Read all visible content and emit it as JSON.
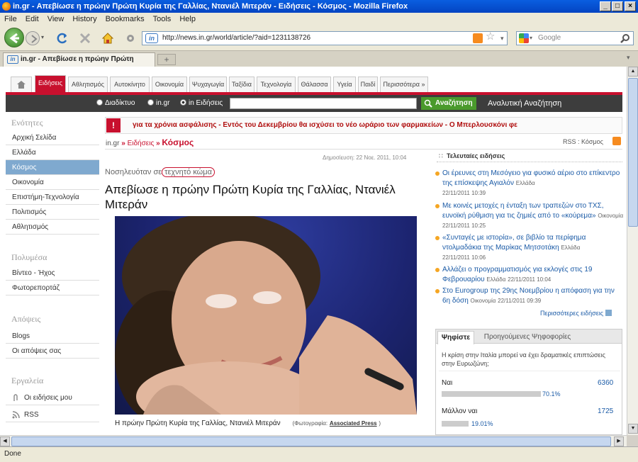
{
  "browser": {
    "window_title": "in.gr - Απεβίωσε η πρώην Πρώτη Κυρία της Γαλλίας, Ντανιέλ Μιτεράν - Ειδήσεις - Κόσμος - Mozilla Firefox",
    "menu": [
      "File",
      "Edit",
      "View",
      "History",
      "Bookmarks",
      "Tools",
      "Help"
    ],
    "url": "http://news.in.gr/world/article/?aid=1231138726",
    "search_placeholder": "Google",
    "tab_title": "in.gr - Απεβίωσε η πρώην Πρώτη Κυρί...",
    "new_tab": "+",
    "status": "Done"
  },
  "site": {
    "tabs": [
      "Ειδήσεις",
      "Αθλητισμός",
      "Αυτοκίνητο",
      "Οικονομία",
      "Ψυχαγωγία",
      "Ταξίδια",
      "Τεχνολογία",
      "Θάλασσα",
      "Υγεία",
      "Παιδί",
      "Περισσότερα »"
    ],
    "search_options": [
      "Διαδίκτυο",
      "in.gr",
      "in Ειδήσεις"
    ],
    "search_button": "Αναζήτηση",
    "advanced_search": "Αναλυτική Αναζήτηση",
    "sidebar": {
      "sections": [
        {
          "heading": "Ενότητες",
          "items": [
            "Αρχική Σελίδα",
            "Ελλάδα",
            "Κόσμος",
            "Οικονομία",
            "Επιστήμη-Τεχνολογία",
            "Πολιτισμός",
            "Αθλητισμός"
          ]
        },
        {
          "heading": "Πολυμέσα",
          "items": [
            "Βίντεο - Ήχος",
            "Φωτορεπορτάζ"
          ]
        },
        {
          "heading": "Απόψεις",
          "items": [
            "Blogs",
            "Οι απόψεις σας"
          ]
        },
        {
          "heading": "Εργαλεία",
          "items": [
            "Οι ειδήσεις μου",
            "RSS"
          ]
        }
      ]
    },
    "ticker": "για τα χρόνια ασφάλισης   -   Εντός του Δεκεμβρίου θα ισχύσει το νέο ωράριο των φαρμακείων   -   Ο Μπερλουσκόνι φε",
    "breadcrumb": {
      "root": "in.gr",
      "sep": "»",
      "section": "Ειδήσεις",
      "current": "Κόσμος"
    },
    "rss_label": "RSS : Κόσμος",
    "published": "Δημοσίευση: 22 Νοε. 2011, 10:04",
    "article": {
      "kicker_prefix": "Νοσηλευόταν σε",
      "kicker_highlight": "τεχνητό κώμα",
      "title": "Απεβίωσε η πρώην Πρώτη Κυρία της Γαλλίας, Ντανιέλ Μιτεράν",
      "caption": "Η πρώην Πρώτη Κυρία της Γαλλίας, Ντανιέλ Μιτεράν",
      "photo_label": "(Φωτογραφία:",
      "photo_credit": "Associated Press",
      "photo_close": ")"
    },
    "latest": {
      "heading": "Τελευταίες ειδήσεις",
      "items": [
        {
          "text": "Οι έρευνες στη Μεσόγειο για φυσικό αέριο στο επίκεντρο της επίσκεψης Αγιαλόν",
          "section": "Ελλάδα",
          "time": "22/11/2011 10:39"
        },
        {
          "text": "Με κοινές μετοχές η ένταξη των τραπεζών στο ΤΧΣ, ευνοϊκή ρύθμιση για τις ζημιές από το «κούρεμα»",
          "section": "Οικονομία",
          "time": "22/11/2011 10:25"
        },
        {
          "text": "«Συνταγές με ιστορία», σε βιβλίο τα περίφημα ντολμαδάκια της Μαρίκας Μητσοτάκη",
          "section": "Ελλάδα",
          "time": "22/11/2011 10:06"
        },
        {
          "text": "Αλλάζει ο προγραμματισμός για εκλογές στις 19 Φεβρουαρίου",
          "section": "Ελλάδα",
          "time": "22/11/2011 10:04"
        },
        {
          "text": "Στο Eurogroup της 29ης Νοεμβρίου η απόφαση για την 6η δόση",
          "section": "Οικονομία",
          "time": "22/11/2011 09:39"
        }
      ],
      "more": "Περισσότερες ειδήσεις"
    },
    "poll": {
      "tabs": [
        "Ψηφίστε",
        "Προηγούμενες Ψηφοφορίες"
      ],
      "question": "Η κρίση στην Ιταλία μπορεί να έχει δραματικές επιπτώσεις στην Ευρωζώνη;",
      "options": [
        {
          "label": "Ναι",
          "votes": "6360",
          "percent": "70.1%",
          "fraction": 0.701
        },
        {
          "label": "Μάλλον ναι",
          "votes": "1725",
          "percent": "19.01%",
          "fraction": 0.1901
        }
      ]
    }
  }
}
